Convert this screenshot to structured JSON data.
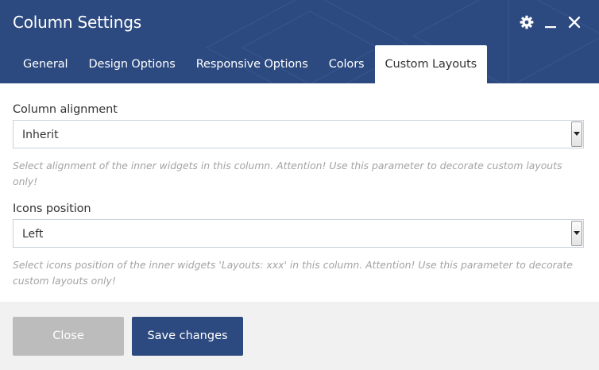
{
  "dialog": {
    "title": "Column Settings",
    "controls": {
      "settings_icon": "gear-icon",
      "minimize_icon": "minimize-icon",
      "close_icon": "close-icon"
    }
  },
  "tabs": [
    {
      "label": "General",
      "active": false
    },
    {
      "label": "Design Options",
      "active": false
    },
    {
      "label": "Responsive Options",
      "active": false
    },
    {
      "label": "Colors",
      "active": false
    },
    {
      "label": "Custom Layouts",
      "active": true
    }
  ],
  "fields": {
    "column_alignment": {
      "label": "Column alignment",
      "value": "Inherit",
      "help": "Select alignment of the inner widgets in this column. Attention! Use this parameter to decorate custom layouts only!"
    },
    "icons_position": {
      "label": "Icons position",
      "value": "Left",
      "help": "Select icons position of the inner widgets 'Layouts: xxx' in this column. Attention! Use this parameter to decorate custom layouts only!"
    }
  },
  "footer": {
    "close_label": "Close",
    "save_label": "Save changes"
  },
  "colors": {
    "header_bg": "#2c4a80",
    "primary_button": "#2c4a80",
    "disabled_button": "#bcbcbc",
    "help_text": "#a3a3a3"
  }
}
